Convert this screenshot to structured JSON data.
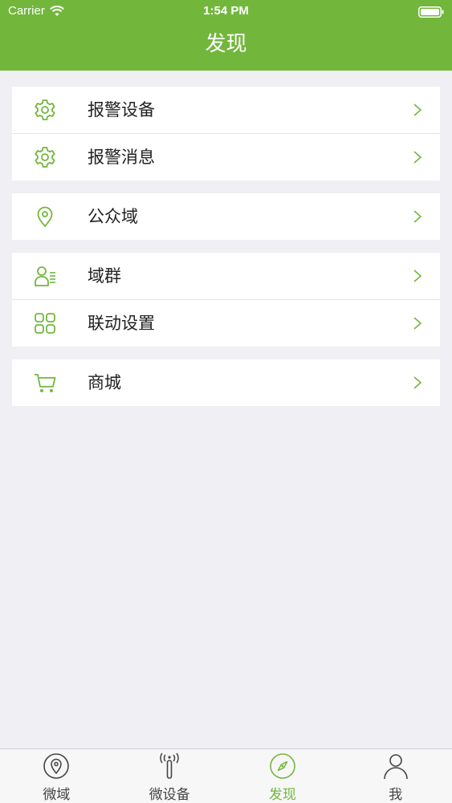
{
  "status_bar": {
    "carrier": "Carrier",
    "time": "1:54 PM"
  },
  "header": {
    "title": "发现"
  },
  "groups": [
    {
      "items": [
        {
          "label": "报警设备",
          "icon": "gear-icon"
        },
        {
          "label": "报警消息",
          "icon": "gear-icon"
        }
      ]
    },
    {
      "items": [
        {
          "label": "公众域",
          "icon": "location-pin-icon"
        }
      ]
    },
    {
      "items": [
        {
          "label": "域群",
          "icon": "person-list-icon"
        },
        {
          "label": "联动设置",
          "icon": "grid-icon"
        }
      ]
    },
    {
      "items": [
        {
          "label": "商城",
          "icon": "cart-icon"
        }
      ]
    }
  ],
  "tabbar": {
    "tabs": [
      {
        "label": "微域",
        "icon": "location-pin-icon",
        "active": false
      },
      {
        "label": "微设备",
        "icon": "antenna-icon",
        "active": false
      },
      {
        "label": "发现",
        "icon": "compass-icon",
        "active": true
      },
      {
        "label": "我",
        "icon": "person-icon",
        "active": false
      }
    ]
  },
  "colors": {
    "accent": "#72b73c",
    "background": "#efeff4",
    "tab_inactive": "#444444"
  }
}
